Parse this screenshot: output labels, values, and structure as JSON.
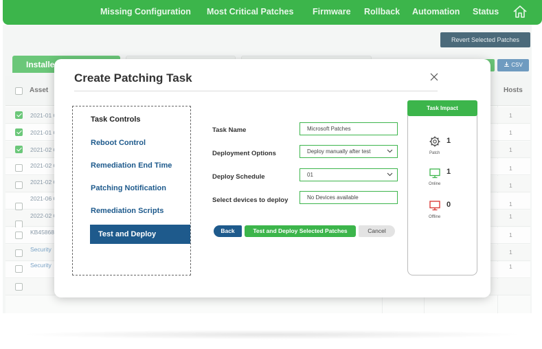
{
  "nav": {
    "items": [
      "Missing Configuration",
      "Most Critical Patches",
      "Firmware",
      "Rollback",
      "Automation",
      "Status"
    ],
    "home_icon": "home-icon"
  },
  "background": {
    "revert_button": "Revert Selected Patches",
    "tab_installed": "Installe",
    "csv_button": "CSV",
    "table": {
      "headers": {
        "asset": "Asset",
        "hosts": "Hosts"
      },
      "rows": [
        {
          "asset": "2021-01 C",
          "hosts": "1",
          "checked": true
        },
        {
          "asset": "2021-01 C",
          "hosts": "1",
          "checked": true
        },
        {
          "asset": "2021-02 C",
          "hosts": "1",
          "checked": true
        },
        {
          "asset": "2021-02 C",
          "hosts": "1",
          "checked": false
        },
        {
          "asset": "2021-02 C",
          "hosts": "1",
          "checked": false
        },
        {
          "asset": "2021-06 C",
          "hosts": "1",
          "checked": false
        },
        {
          "asset": "2022-02 C",
          "hosts": "1",
          "checked": false
        },
        {
          "asset": "KB45868",
          "hosts": "1",
          "checked": false
        },
        {
          "asset": "Security",
          "hosts": "1",
          "checked": false
        },
        {
          "asset": "Security",
          "hosts": "1",
          "checked": false
        },
        {
          "asset": "",
          "hosts": "",
          "checked": false
        }
      ]
    }
  },
  "modal": {
    "title": "Create Patching Task",
    "close_icon": "close-icon",
    "steps": [
      "Task Controls",
      "Reboot Control",
      "Remediation End Time",
      "Patching Notification",
      "Remediation Scripts"
    ],
    "active_step": "Test and Deploy",
    "form": {
      "task_name": {
        "label": "Task Name",
        "value": "Microsoft Patches"
      },
      "deployment_options": {
        "label": "Deployment Options",
        "value": "Deploy manually after test"
      },
      "deploy_schedule": {
        "label": "Deploy Schedule",
        "value": "01"
      },
      "select_devices": {
        "label": "Select devices to deploy",
        "value": "No Devices available"
      }
    },
    "buttons": {
      "back": "Back",
      "deploy": "Test and Deploy Selected Patches",
      "cancel": "Cancel"
    },
    "impact": {
      "title": "Task Impact",
      "patch": {
        "count": "1",
        "label": "Patch",
        "icon": "gear-icon"
      },
      "online": {
        "count": "1",
        "label": "Online",
        "icon": "monitor-icon",
        "color": "#3cb54b"
      },
      "offline": {
        "count": "0",
        "label": "Offline",
        "icon": "monitor-icon",
        "color": "#d9302c"
      }
    }
  },
  "colors": {
    "brand_green": "#3cb54b",
    "primary_blue": "#1e5a8c",
    "slate": "#4b6a7a"
  }
}
